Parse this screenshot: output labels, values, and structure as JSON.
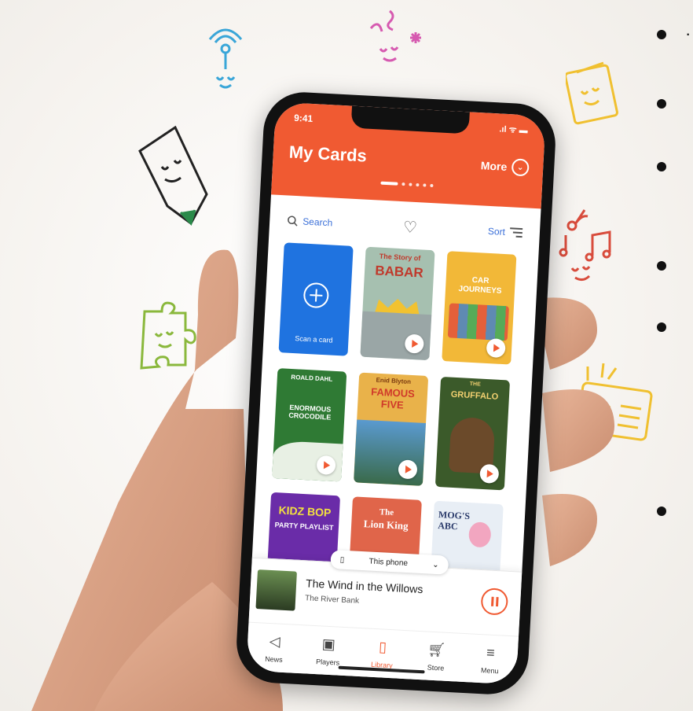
{
  "status": {
    "time": "9:41",
    "signal": ".ıl ᯤ ▬"
  },
  "header": {
    "title": "My Cards",
    "more_label": "More"
  },
  "toolbar": {
    "search_label": "Search",
    "sort_label": "Sort"
  },
  "cards": [
    {
      "label": "Scan a card",
      "type": "scan",
      "color": "#1f73e0"
    },
    {
      "label": "The Story of BABAR",
      "line1": "The Story of",
      "line2": "BABAR",
      "color": "#a6c0b0"
    },
    {
      "label": "CAR JOURNEYS",
      "line1": "CAR",
      "line2": "JOURNEYS",
      "color": "#f2b838"
    },
    {
      "label": "ENORMOUS CROCODILE",
      "line1": "ROALD DAHL",
      "line2": "ENORMOUS CROCODILE",
      "color": "#2f7a34"
    },
    {
      "label": "FAMOUS FIVE",
      "line1": "Enid Blyton",
      "line2": "FAMOUS FIVE",
      "color": "#e9b24a"
    },
    {
      "label": "GRUFFALO",
      "line1": "THE",
      "line2": "GRUFFALO",
      "color": "#3b5a2a"
    },
    {
      "label": "KIDZ BOP PARTY PLAYLIST",
      "line1": "KIDZ BOP",
      "line2": "PARTY PLAYLIST",
      "color": "#6a2ca8"
    },
    {
      "label": "The Lion King",
      "line1": "The",
      "line2": "Lion King",
      "color": "#e0654a"
    },
    {
      "label": "MOG'S ABC",
      "line1": "MOG'S",
      "line2": "ABC",
      "color": "#e8eef5"
    }
  ],
  "player": {
    "device": "This phone",
    "track_title": "The Wind in the Willows",
    "track_subtitle": "The River Bank"
  },
  "tabs": [
    {
      "label": "News",
      "icon": "megaphone-icon",
      "glyph": "◁"
    },
    {
      "label": "Players",
      "icon": "players-icon",
      "glyph": "▣"
    },
    {
      "label": "Library",
      "icon": "library-icon",
      "glyph": "▯",
      "active": true
    },
    {
      "label": "Store",
      "icon": "cart-icon",
      "glyph": "🛒︎"
    },
    {
      "label": "Menu",
      "icon": "menu-icon",
      "glyph": "≡"
    }
  ],
  "colors": {
    "accent": "#f05a32",
    "link": "#3a6fd8"
  }
}
